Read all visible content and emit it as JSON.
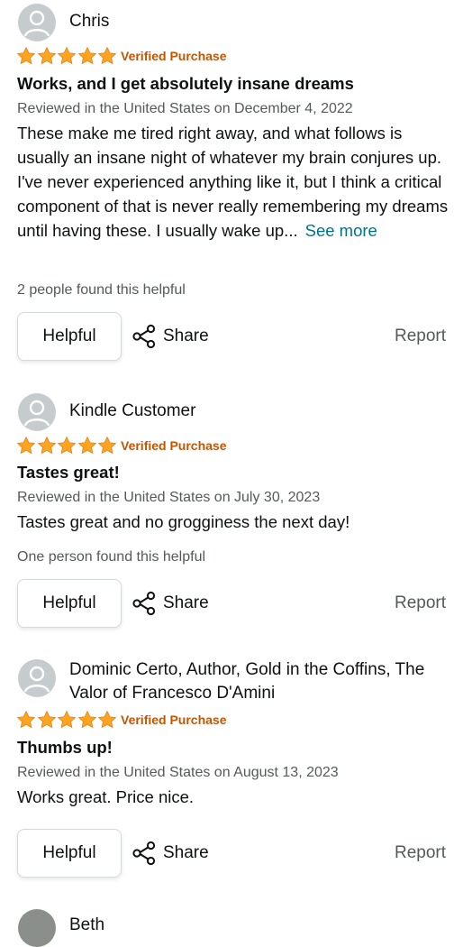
{
  "reviews": [
    {
      "reviewer": "Chris",
      "rating": 5,
      "verified": "Verified Purchase",
      "title": "Works, and I get absolutely insane dreams",
      "meta": "Reviewed in the United States on December 4, 2022",
      "body": "These make me tired right away, and what follows is usually an insane night of whatever my brain conjures up. I've never experienced anything like it, but I think a critical component of that is never really remembering my dreams until having these. I usually wake up...",
      "see_more": "See more",
      "helpful_count": "2 people found this helpful",
      "helpful_label": "Helpful",
      "share_label": "Share",
      "report_label": "Report"
    },
    {
      "reviewer": "Kindle Customer",
      "rating": 5,
      "verified": "Verified Purchase",
      "title": "Tastes great!",
      "meta": "Reviewed in the United States on July 30, 2023",
      "body": "Tastes great and no grogginess the next day!",
      "helpful_count": "One person found this helpful",
      "helpful_label": "Helpful",
      "share_label": "Share",
      "report_label": "Report"
    },
    {
      "reviewer": "Dominic Certo, Author, Gold in the Coffins, The Valor of Francesco D'Amini",
      "rating": 5,
      "verified": "Verified Purchase",
      "title": "Thumbs up!",
      "meta": "Reviewed in the United States on August 13, 2023",
      "body": "Works great. Price nice.",
      "helpful_label": "Helpful",
      "share_label": "Share",
      "report_label": "Report"
    }
  ],
  "next_reviewer_partial": "Beth",
  "colors": {
    "star": "#ffa41c",
    "verified": "#c45500",
    "link": "#007185",
    "muted": "#565959"
  },
  "icons": [
    "avatar-placeholder-icon",
    "star-icon",
    "share-icon"
  ]
}
